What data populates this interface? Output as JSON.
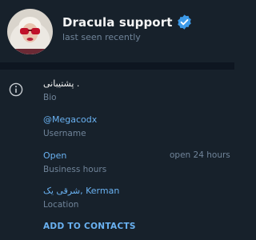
{
  "profile": {
    "name": "Dracula support",
    "status": "last seen recently",
    "verified": true,
    "accent_color": "#6ab2f2",
    "background_color": "#17212b"
  },
  "info": {
    "icon": "info-icon",
    "bio": {
      "value": "پشتیبانی .",
      "label": "Bio"
    },
    "username": {
      "value": "@Megacodx",
      "label": "Username"
    },
    "business_hours": {
      "value": "Open",
      "label": "Business hours",
      "extra": "open 24 hours"
    },
    "location": {
      "value": "شرقی یک, Kerman",
      "label": "Location"
    }
  },
  "actions": {
    "add_to_contacts": "ADD TO CONTACTS"
  }
}
